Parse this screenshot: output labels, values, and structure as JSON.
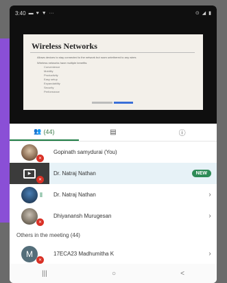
{
  "status": {
    "time": "3:40",
    "icons_left": [
      "chat-icon",
      "phone-icon",
      "shield-icon",
      "more-icon"
    ],
    "icons_right": [
      "wifi-icon",
      "signal-icon",
      "battery-icon"
    ]
  },
  "slide": {
    "title": "Wireless Networks",
    "bullets": [
      "Allows devices to stay connected to the network but roam untethered to any wires",
      "Wireless networks have multiple benefits:"
    ],
    "sub_bullets": [
      "Convenience",
      "Mobility",
      "Productivity",
      "Easy setup",
      "Expandability",
      "Security",
      "Performance"
    ]
  },
  "tabs": {
    "people_count": "(44)",
    "people_icon": "people-icon",
    "chat_icon": "chat-icon",
    "info_icon": "info-icon"
  },
  "participants": [
    {
      "name": "Gopinath samydurai (You)",
      "avatar": "photo",
      "state": "muted"
    },
    {
      "name": "Dr. Natraj Nathan",
      "avatar": "presentation",
      "state": "muted",
      "badge": "NEW"
    },
    {
      "name": "Dr. Natraj Nathan",
      "avatar": "photo",
      "state": "speaking"
    },
    {
      "name": "Dhiyanansh Murugesan",
      "avatar": "photo",
      "state": "muted"
    }
  ],
  "section": {
    "label": "Others in the meeting (44)"
  },
  "others": [
    {
      "name": "17ECA23 Madhumitha K",
      "initial": "M",
      "state": "muted"
    }
  ],
  "navbar": {
    "recents": "|||",
    "home": "○",
    "back": "<"
  },
  "colors": {
    "accent_green": "#1e7d44",
    "badge_green": "#2e8b57",
    "mute_red": "#d93025",
    "highlight": "#e7f2f7"
  }
}
